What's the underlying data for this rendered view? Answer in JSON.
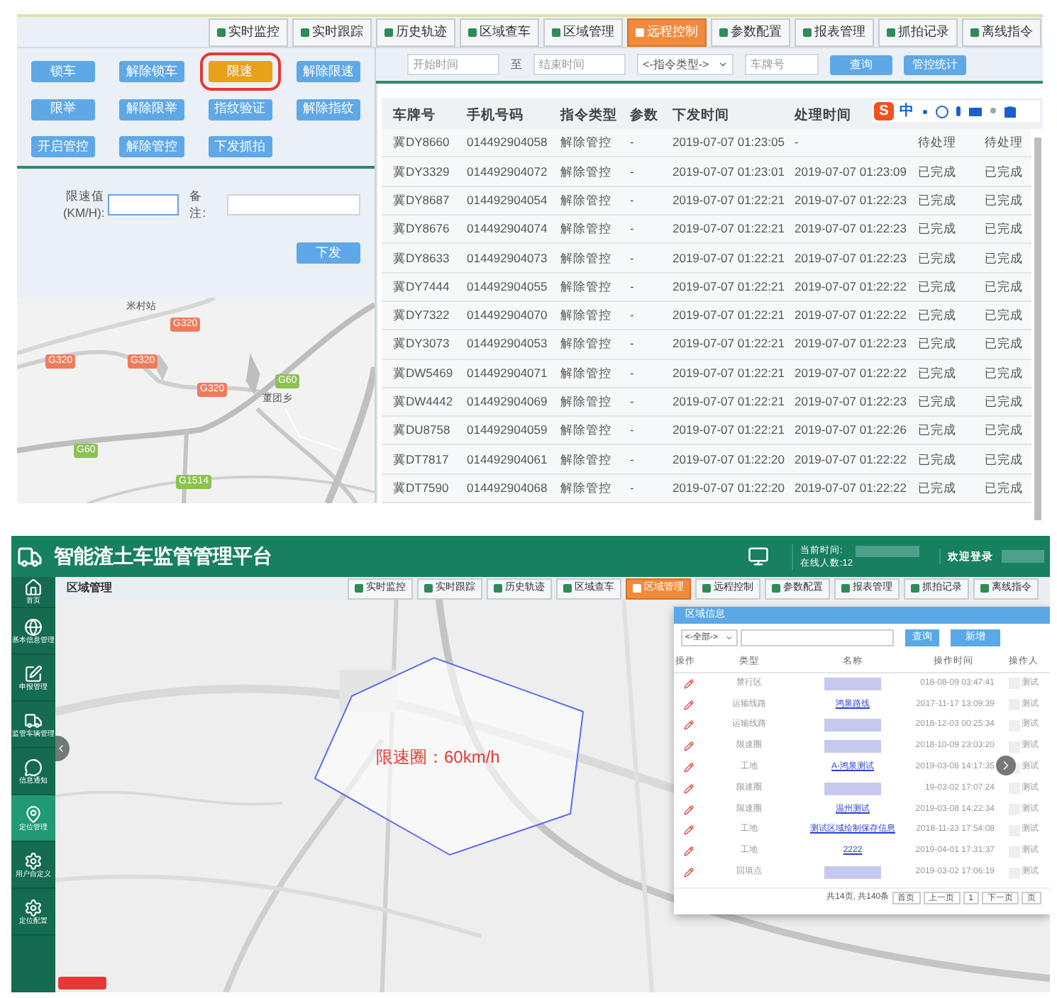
{
  "top": {
    "nav": [
      {
        "label": "实时监控",
        "selected": false
      },
      {
        "label": "实时跟踪",
        "selected": false
      },
      {
        "label": "历史轨迹",
        "selected": false
      },
      {
        "label": "区域查车",
        "selected": false
      },
      {
        "label": "区域管理",
        "selected": false
      },
      {
        "label": "远程控制",
        "selected": true
      },
      {
        "label": "参数配置",
        "selected": false
      },
      {
        "label": "报表管理",
        "selected": false
      },
      {
        "label": "抓拍记录",
        "selected": false
      },
      {
        "label": "离线指令",
        "selected": false
      }
    ],
    "commands": [
      {
        "label": "锁车",
        "selected": false
      },
      {
        "label": "解除锁车",
        "selected": false
      },
      {
        "label": "限速",
        "selected": true
      },
      {
        "label": "解除限速",
        "selected": false
      },
      {
        "label": "限举",
        "selected": false
      },
      {
        "label": "解除限举",
        "selected": false
      },
      {
        "label": "指纹验证",
        "selected": false
      },
      {
        "label": "解除指纹",
        "selected": false
      },
      {
        "label": "开启管控",
        "selected": false
      },
      {
        "label": "解除管控",
        "selected": false
      },
      {
        "label": "下发抓拍",
        "selected": false
      }
    ],
    "form": {
      "speed_label": "限速值(KM/H):",
      "remark_label": "备注:",
      "submit": "下发"
    },
    "map_labels": [
      {
        "kind": "station",
        "text": "米村站"
      },
      {
        "kind": "red",
        "text": "G320"
      },
      {
        "kind": "red",
        "text": "G320"
      },
      {
        "kind": "red",
        "text": "G320"
      },
      {
        "kind": "red",
        "text": "G320"
      },
      {
        "kind": "green",
        "text": "G60"
      },
      {
        "kind": "place",
        "text": "董团乡"
      },
      {
        "kind": "green",
        "text": "G60"
      },
      {
        "kind": "green",
        "text": "G1514"
      }
    ],
    "filter": {
      "start_placeholder": "开始时间",
      "to": "至",
      "end_placeholder": "结束时间",
      "type_select": "<-指令类型->",
      "plate_placeholder": "车牌号",
      "query": "查询",
      "stats": "管控统计"
    },
    "ime": {
      "logo": "S",
      "text": "中"
    },
    "table": {
      "columns": [
        "车牌号",
        "手机号码",
        "指令类型",
        "参数",
        "下发时间",
        "处理时间"
      ],
      "rows": [
        [
          "冀DY8660",
          "014492904058",
          "解除管控",
          "-",
          "2019-07-07 01:23:05",
          "-",
          "待处理",
          "待处理"
        ],
        [
          "冀DY3329",
          "014492904072",
          "解除管控",
          "-",
          "2019-07-07 01:23:01",
          "2019-07-07 01:23:09",
          "已完成",
          "已完成"
        ],
        [
          "冀DY8687",
          "014492904054",
          "解除管控",
          "-",
          "2019-07-07 01:22:21",
          "2019-07-07 01:22:23",
          "已完成",
          "已完成"
        ],
        [
          "冀DY8676",
          "014492904074",
          "解除管控",
          "-",
          "2019-07-07 01:22:21",
          "2019-07-07 01:22:23",
          "已完成",
          "已完成"
        ],
        [
          "冀DY8633",
          "014492904073",
          "解除管控",
          "-",
          "2019-07-07 01:22:21",
          "2019-07-07 01:22:23",
          "已完成",
          "已完成"
        ],
        [
          "冀DY7444",
          "014492904055",
          "解除管控",
          "-",
          "2019-07-07 01:22:21",
          "2019-07-07 01:22:22",
          "已完成",
          "已完成"
        ],
        [
          "冀DY7322",
          "014492904070",
          "解除管控",
          "-",
          "2019-07-07 01:22:21",
          "2019-07-07 01:22:22",
          "已完成",
          "已完成"
        ],
        [
          "冀DY3073",
          "014492904053",
          "解除管控",
          "-",
          "2019-07-07 01:22:21",
          "2019-07-07 01:22:23",
          "已完成",
          "已完成"
        ],
        [
          "冀DW5469",
          "014492904071",
          "解除管控",
          "-",
          "2019-07-07 01:22:21",
          "2019-07-07 01:22:22",
          "已完成",
          "已完成"
        ],
        [
          "冀DW4442",
          "014492904069",
          "解除管控",
          "-",
          "2019-07-07 01:22:21",
          "2019-07-07 01:22:23",
          "已完成",
          "已完成"
        ],
        [
          "冀DU8758",
          "014492904059",
          "解除管控",
          "-",
          "2019-07-07 01:22:21",
          "2019-07-07 01:22:26",
          "已完成",
          "已完成"
        ],
        [
          "冀DT7817",
          "014492904061",
          "解除管控",
          "-",
          "2019-07-07 01:22:20",
          "2019-07-07 01:22:22",
          "已完成",
          "已完成"
        ],
        [
          "冀DT7590",
          "014492904068",
          "解除管控",
          "-",
          "2019-07-07 01:22:20",
          "2019-07-07 01:22:22",
          "已完成",
          "已完成"
        ]
      ]
    }
  },
  "bottom": {
    "title": "智能渣土车监管管理平台",
    "time_label": "当前时间:",
    "online": "在线人数:12",
    "welcome": "欢迎登录",
    "section": "区域管理",
    "nav": [
      {
        "label": "实时监控",
        "selected": false
      },
      {
        "label": "实时跟踪",
        "selected": false
      },
      {
        "label": "历史轨迹",
        "selected": false
      },
      {
        "label": "区域查车",
        "selected": false
      },
      {
        "label": "区域管理",
        "selected": true
      },
      {
        "label": "远程控制",
        "selected": false
      },
      {
        "label": "参数配置",
        "selected": false
      },
      {
        "label": "报表管理",
        "selected": false
      },
      {
        "label": "抓拍记录",
        "selected": false
      },
      {
        "label": "离线指令",
        "selected": false
      }
    ],
    "sidebar": [
      {
        "kind": "home",
        "label": "首页",
        "selected": false
      },
      {
        "kind": "globe",
        "label": "基本信息管理",
        "selected": false
      },
      {
        "kind": "edit",
        "label": "申报管理",
        "selected": false
      },
      {
        "kind": "truck",
        "label": "监管车辆管理",
        "selected": false
      },
      {
        "kind": "chat",
        "label": "信息通知",
        "selected": false
      },
      {
        "kind": "pin",
        "label": "定位管理",
        "selected": true
      },
      {
        "kind": "gear",
        "label": "用户自定义",
        "selected": false
      },
      {
        "kind": "gear",
        "label": "定位配置",
        "selected": false
      }
    ],
    "map_label": "限速圈：60km/h",
    "dialog": {
      "title": "区域信息",
      "select": "<-全部->",
      "query": "查询",
      "add": "新增",
      "columns": [
        "操作",
        "类型",
        "名称",
        "操作时间",
        "操作人"
      ],
      "rows": [
        {
          "type": "禁行区",
          "name": "",
          "time": "018-08-09 03:47:41",
          "user": "测试"
        },
        {
          "type": "运输线路",
          "name": "鸿泉路线",
          "time": "2017-11-17 13:09:39",
          "user": "测试"
        },
        {
          "type": "运输线路",
          "name": "",
          "time": "2018-12-03 00:25:34",
          "user": "测试"
        },
        {
          "type": "限速圈",
          "name": "",
          "time": "2018-10-09 23:03:20",
          "user": "测试"
        },
        {
          "type": "工地",
          "name": "A-鸿泉测试",
          "time": "2019-03-08 14:17:35",
          "user": "测试"
        },
        {
          "type": "限速圈",
          "name": "",
          "time": "19-03-02 17:07:24",
          "user": "测试"
        },
        {
          "type": "限速圈",
          "name": "温州测试",
          "time": "2019-03-08 14:22:34",
          "user": "测试"
        },
        {
          "type": "工地",
          "name": "测试区域绘制保存信息",
          "time": "2018-11-23 17:54:08",
          "user": "测试"
        },
        {
          "type": "工地",
          "name": "2222",
          "time": "2019-04-01 17:31:37",
          "user": "测试"
        },
        {
          "type": "回填点",
          "name": "",
          "time": "2019-03-02 17:06:19",
          "user": "测试"
        }
      ],
      "pager": {
        "summary": "共14页, 共140条",
        "buttons": [
          "首页",
          "上一页",
          "1",
          "下一页",
          "页"
        ]
      }
    }
  }
}
